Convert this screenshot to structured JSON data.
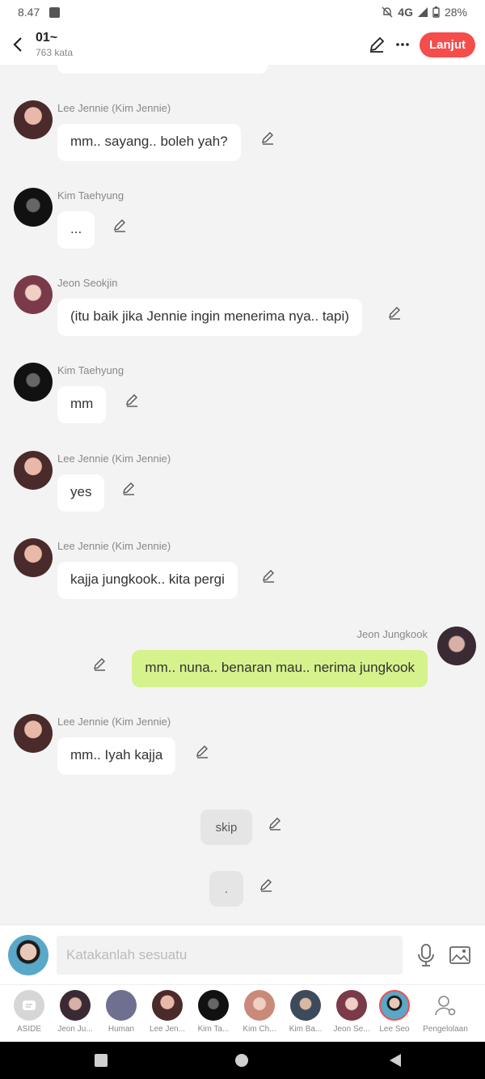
{
  "status": {
    "time": "8.47",
    "network": "4G",
    "battery": "28%"
  },
  "header": {
    "title": "01~",
    "word_count": "763 kata",
    "next_label": "Lanjut"
  },
  "messages": [
    {
      "name": "Lee Jennie (Kim Jennie)",
      "text": "mm.. sayang.. boleh yah?"
    },
    {
      "name": "Kim Taehyung",
      "text": "..."
    },
    {
      "name": "Jeon Seokjin",
      "text": "(itu baik jika Jennie ingin menerima nya.. tapi)"
    },
    {
      "name": "Kim Taehyung",
      "text": "mm"
    },
    {
      "name": "Lee Jennie (Kim Jennie)",
      "text": "yes"
    },
    {
      "name": "Lee Jennie (Kim Jennie)",
      "text": "kajja jungkook.. kita pergi"
    },
    {
      "name": "Jeon Jungkook",
      "text": "mm.. nuna.. benaran mau.. nerima jungkook"
    },
    {
      "name": "Lee Jennie (Kim Jennie)",
      "text": "mm.. Iyah kajja"
    }
  ],
  "narration": [
    {
      "text": "skip"
    },
    {
      "text": "."
    }
  ],
  "input": {
    "placeholder": "Katakanlah sesuatu"
  },
  "characters": [
    {
      "label": "ASIDE",
      "color": "#cfcfcf"
    },
    {
      "label": "Jeon Ju...",
      "color": "#6b4a52"
    },
    {
      "label": "Human",
      "color": "#6f6f8f"
    },
    {
      "label": "Lee Jen...",
      "color": "#8a4a4a"
    },
    {
      "label": "Kim Ta...",
      "color": "#222222"
    },
    {
      "label": "Kim Ch...",
      "color": "#c98a7a"
    },
    {
      "label": "Kim Ba...",
      "color": "#3d4a5c"
    },
    {
      "label": "Jeon Se...",
      "color": "#a45a6a"
    },
    {
      "label": "Lee Seo",
      "color": "#4a8ab0"
    },
    {
      "label": "Pengelolaan",
      "color": "#999999"
    }
  ],
  "colors": {
    "accent": "#f54c4c",
    "my_bubble": "#d6f28c"
  }
}
